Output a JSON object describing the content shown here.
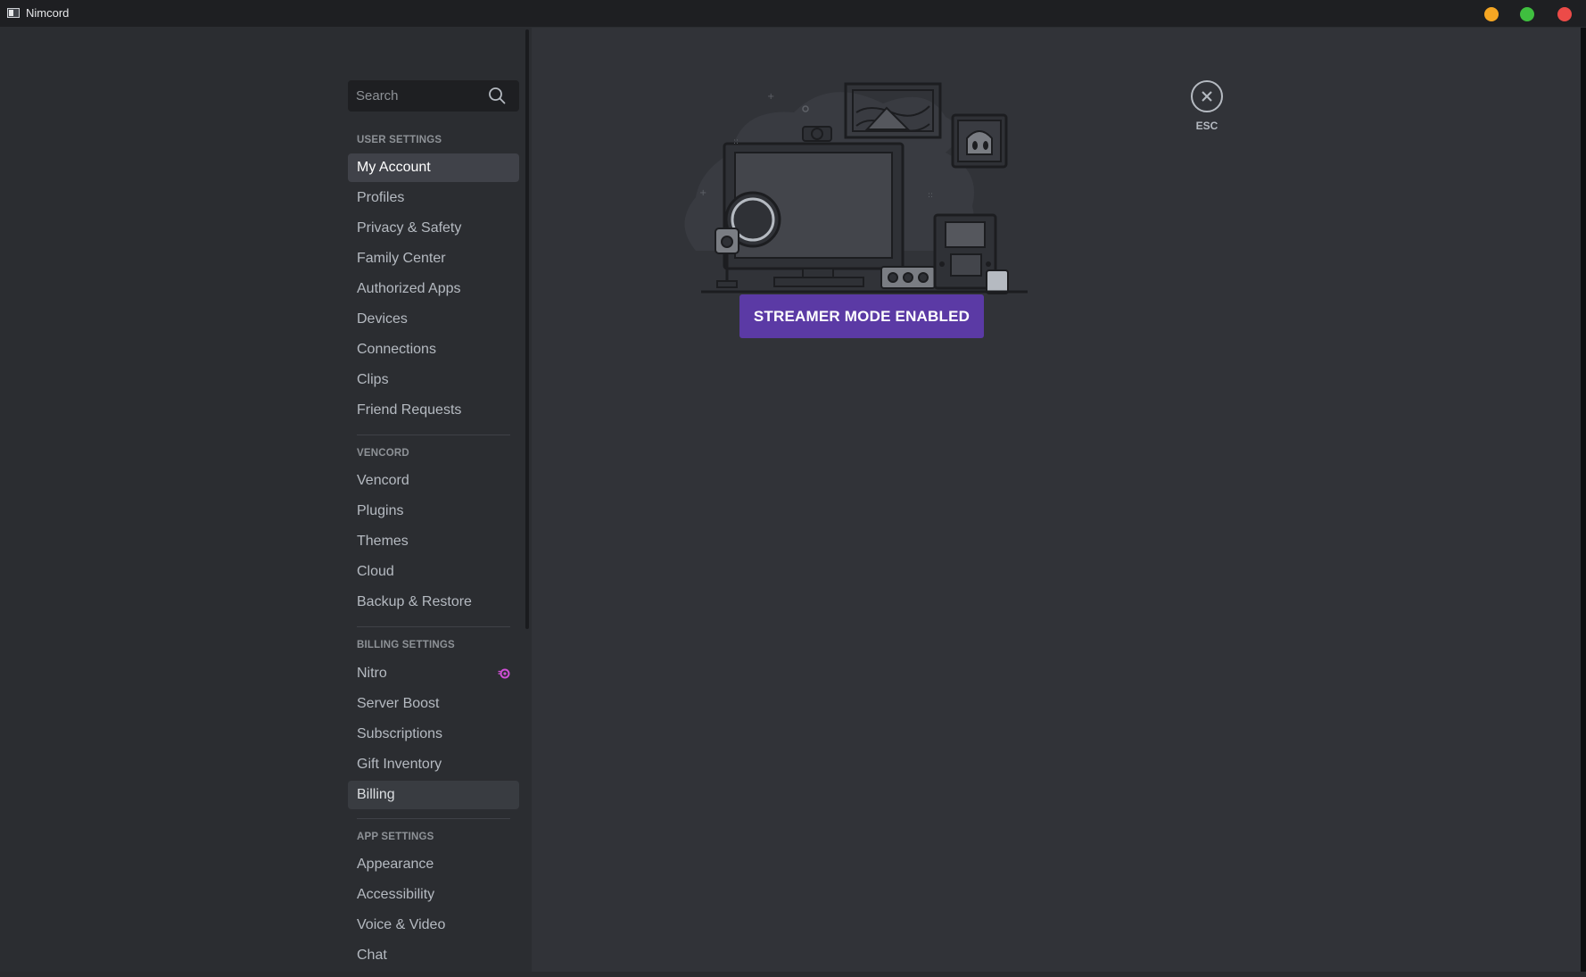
{
  "window": {
    "title": "Nimcord",
    "controls": {
      "minimize_color": "#f5a623",
      "maximize_color": "#3fbf3f",
      "close_color": "#ec4b48"
    }
  },
  "search": {
    "placeholder": "Search"
  },
  "sidebar": {
    "sections": [
      {
        "header": "USER SETTINGS",
        "items": [
          {
            "label": "My Account",
            "selected": true
          },
          {
            "label": "Profiles"
          },
          {
            "label": "Privacy & Safety"
          },
          {
            "label": "Family Center"
          },
          {
            "label": "Authorized Apps"
          },
          {
            "label": "Devices"
          },
          {
            "label": "Connections"
          },
          {
            "label": "Clips"
          },
          {
            "label": "Friend Requests"
          }
        ]
      },
      {
        "header": "VENCORD",
        "items": [
          {
            "label": "Vencord"
          },
          {
            "label": "Plugins"
          },
          {
            "label": "Themes"
          },
          {
            "label": "Cloud"
          },
          {
            "label": "Backup & Restore"
          }
        ]
      },
      {
        "header": "BILLING SETTINGS",
        "items": [
          {
            "label": "Nitro",
            "icon": "nitro-icon"
          },
          {
            "label": "Server Boost"
          },
          {
            "label": "Subscriptions"
          },
          {
            "label": "Gift Inventory"
          },
          {
            "label": "Billing",
            "hovered": true
          }
        ]
      },
      {
        "header": "APP SETTINGS",
        "items": [
          {
            "label": "Appearance"
          },
          {
            "label": "Accessibility"
          },
          {
            "label": "Voice & Video"
          },
          {
            "label": "Chat"
          }
        ]
      }
    ]
  },
  "content": {
    "illustration": "streamer-mode-illustration",
    "streamer_button": "STREAMER MODE ENABLED",
    "esc_label": "ESC"
  },
  "colors": {
    "accent": "#5b3aa5",
    "background": "#313338",
    "sidebar": "#2b2d31",
    "selected_item": "#404249",
    "nitro": "#d04fd6"
  }
}
